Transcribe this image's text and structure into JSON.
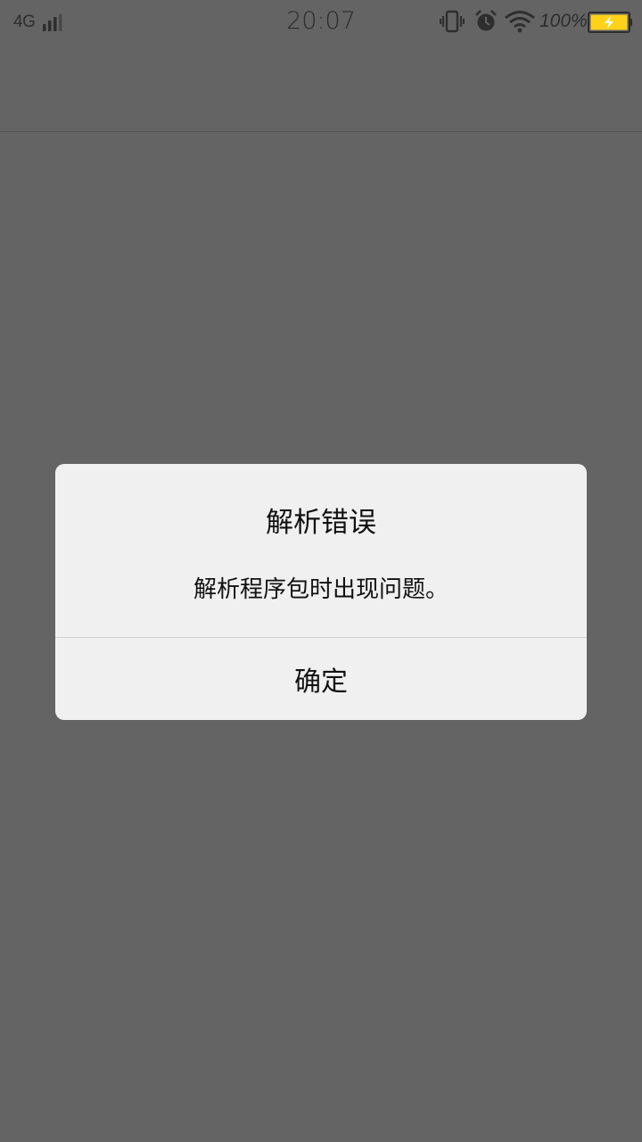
{
  "status_bar": {
    "network": "4G",
    "time": "20:07",
    "battery_percent": "100%",
    "icons": [
      "signal-icon",
      "vibrate-icon",
      "alarm-icon",
      "wifi-icon",
      "battery-charging-icon"
    ],
    "battery_color": "#ffd21a"
  },
  "dialog": {
    "title": "解析错误",
    "message": "解析程序包时出现问题。",
    "confirm_label": "确定"
  },
  "colors": {
    "scrim": "#646464",
    "dialog_bg": "#f0f0f0"
  }
}
